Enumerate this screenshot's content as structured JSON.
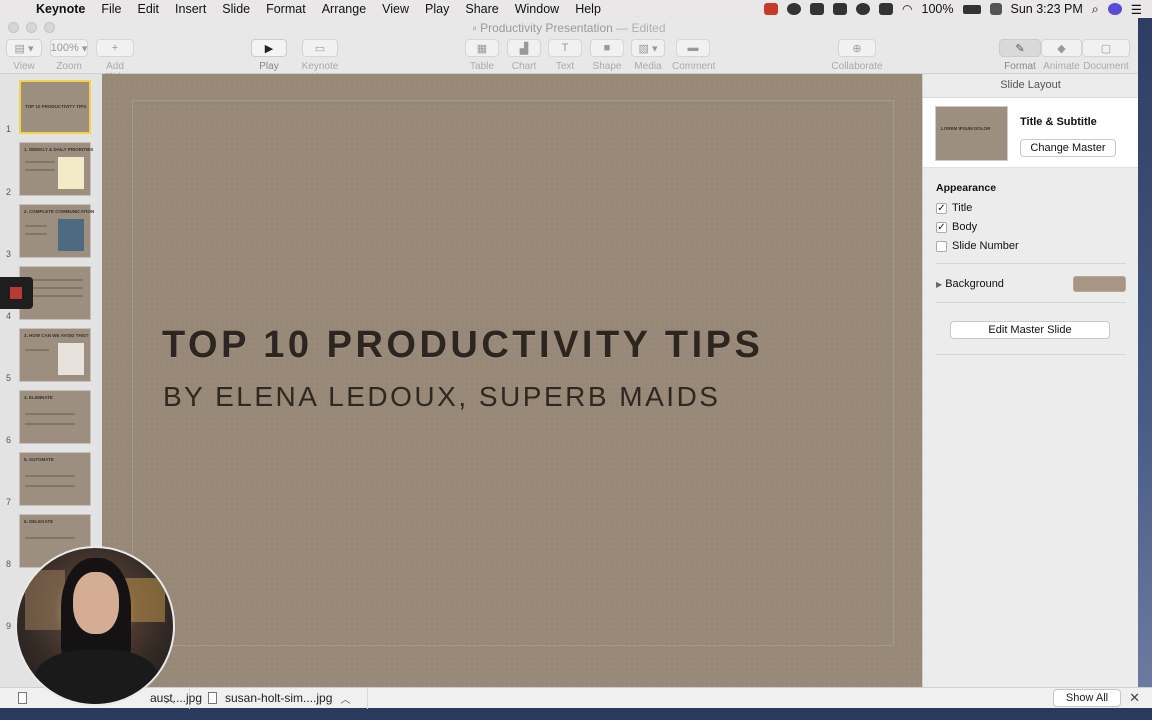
{
  "menubar": {
    "app": "Keynote",
    "items": [
      "File",
      "Edit",
      "Insert",
      "Slide",
      "Format",
      "Arrange",
      "View",
      "Play",
      "Share",
      "Window",
      "Help"
    ],
    "battery": "100%",
    "clock": "Sun 3:23 PM"
  },
  "window": {
    "title": "Productivity Presentation",
    "edited": "— Edited"
  },
  "toolbar": {
    "view": "View",
    "zoom": "Zoom",
    "zoom_value": "100%",
    "add_slide": "Add Slide",
    "play": "Play",
    "keynote_live": "Keynote Live",
    "table": "Table",
    "chart": "Chart",
    "text": "Text",
    "shape": "Shape",
    "media": "Media",
    "comment": "Comment",
    "collaborate": "Collaborate",
    "format": "Format",
    "animate": "Animate",
    "document": "Document"
  },
  "slides": [
    {
      "num": "1",
      "title": "TOP 10 PRODUCTIVITY TIPS"
    },
    {
      "num": "2",
      "title": "1. WEEKLY & DAILY PRIORITIES"
    },
    {
      "num": "3",
      "title": "2. COMPLETE COMMUNICATION"
    },
    {
      "num": "4",
      "title": ""
    },
    {
      "num": "5",
      "title": "3. HOW CAN WE AVOID THIS?"
    },
    {
      "num": "6",
      "title": "4. ELIMINATE"
    },
    {
      "num": "7",
      "title": "5. AUTOMATE"
    },
    {
      "num": "8",
      "title": "6. DELEGATE"
    },
    {
      "num": "9",
      "title": ""
    }
  ],
  "slide": {
    "title": "TOP 10 PRODUCTIVITY TIPS",
    "subtitle": "BY ELENA LEDOUX, SUPERB MAIDS"
  },
  "inspector": {
    "header": "Slide Layout",
    "layout_name": "Title & Subtitle",
    "layout_thumb_text": "LOREM IPSUM DOLOR",
    "change_master": "Change Master",
    "appearance": "Appearance",
    "title_label": "Title",
    "body_label": "Body",
    "slide_number_label": "Slide Number",
    "background": "Background",
    "edit_master": "Edit Master Slide",
    "title_checked": true,
    "body_checked": true,
    "slide_number_checked": false
  },
  "downloads": {
    "file1": "aust....jpg",
    "file2": "susan-holt-sim....jpg",
    "show_all": "Show All"
  }
}
